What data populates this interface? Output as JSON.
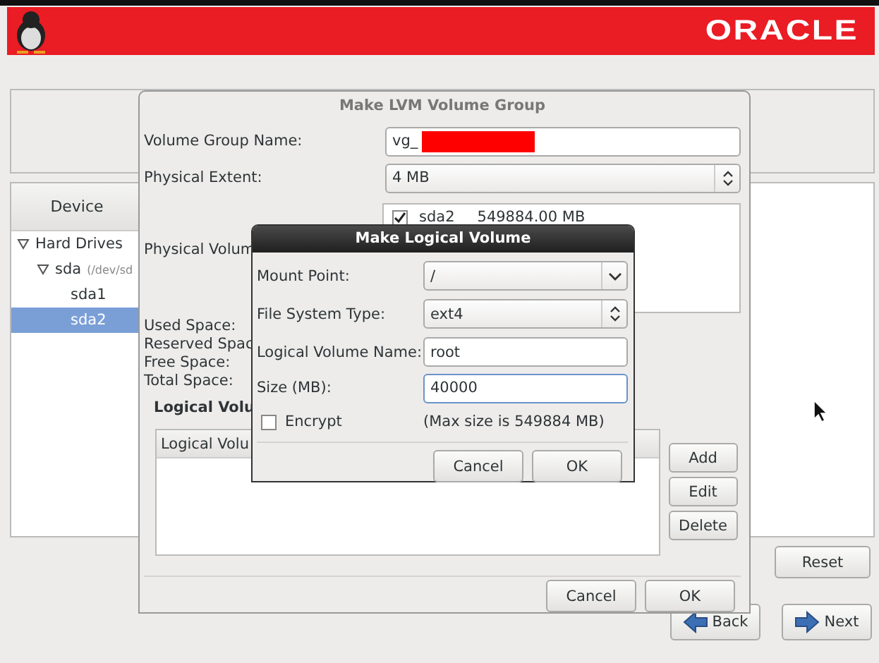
{
  "banner": {
    "logo": "ORACLE"
  },
  "devices": {
    "header": "Device",
    "tree": [
      {
        "label": "Hard Drives",
        "expanded": true,
        "selected": false,
        "children": [
          {
            "label": "sda",
            "detail": "(/dev/sd",
            "expanded": true,
            "selected": false,
            "children": [
              {
                "label": "sda1",
                "selected": false
              },
              {
                "label": "sda2",
                "selected": true
              }
            ]
          }
        ]
      }
    ]
  },
  "actions": [
    {
      "label": "Reset"
    }
  ],
  "nav": [
    {
      "label": "Back",
      "kind": "back"
    },
    {
      "label": "Next",
      "kind": "next"
    }
  ],
  "lvm_dialog": {
    "title": "Make LVM Volume Group",
    "name_label": "Volume Group Name:",
    "name_value": "vg_",
    "extent_label": "Physical Extent:",
    "extent_value": "4 MB",
    "pv_label": "Physical Volum",
    "physical_volumes": [
      {
        "name": "sda2",
        "size": "549884.00 MB",
        "checked": true
      }
    ],
    "space_labels": [
      "Used Space:",
      "Reserved Spac",
      "Free Space:",
      "Total Space:"
    ],
    "lv_heading": "Logical Volu",
    "lv_column": "Logical Volu",
    "side_buttons": [
      "Add",
      "Edit",
      "Delete"
    ],
    "buttons": [
      "Cancel",
      "OK"
    ]
  },
  "lv_dialog": {
    "title": "Make Logical Volume",
    "fields": [
      {
        "label": "Mount Point:",
        "value": "/",
        "kind": "combo",
        "focused": false
      },
      {
        "label": "File System Type:",
        "value": "ext4",
        "kind": "select",
        "focused": false
      },
      {
        "label": "Logical Volume Name:",
        "value": "root",
        "kind": "text",
        "focused": false
      },
      {
        "label": "Size (MB):",
        "value": "40000",
        "kind": "text",
        "focused": true
      }
    ],
    "encrypt": {
      "label": "Encrypt",
      "checked": false
    },
    "max_size": "(Max size is 549884 MB)",
    "buttons": [
      "Cancel",
      "OK"
    ]
  }
}
